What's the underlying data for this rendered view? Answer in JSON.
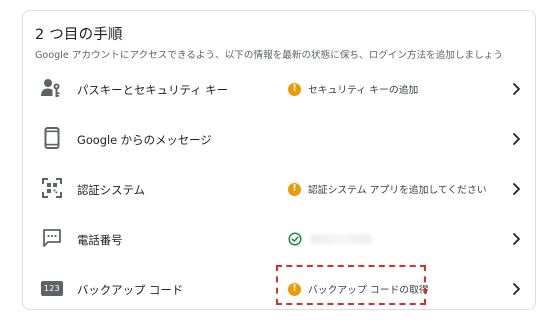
{
  "card": {
    "title": "2 つ目の手順",
    "description": "Google アカウントにアクセスできるよう、以下の情報を最新の状態に保ち、ログイン方法を追加しましょう"
  },
  "rows": [
    {
      "label": "パスキーとセキュリティ キー",
      "icon": "passkey-person-key-icon",
      "status": "セキュリティ キーの追加",
      "status_type": "warning"
    },
    {
      "label": "Google からのメッセージ",
      "icon": "smartphone-icon",
      "status": "",
      "status_type": "none"
    },
    {
      "label": "認証システム",
      "icon": "qr-scan-icon",
      "status": "認証システム アプリを追加してください",
      "status_type": "warning"
    },
    {
      "label": "電話番号",
      "icon": "message-bubble-icon",
      "status": "",
      "status_type": "ok"
    },
    {
      "label": "バックアップ コード",
      "icon": "code-123-icon",
      "icon_text": "123",
      "status": "バックアップ コードの取得",
      "status_type": "warning"
    }
  ],
  "icons": {
    "warning_glyph": "!",
    "chevron": "chevron-right-icon"
  },
  "colors": {
    "warning": "#f29900",
    "ok": "#1e8e3e",
    "icon": "#5f6368",
    "highlight_border": "#d93025"
  }
}
